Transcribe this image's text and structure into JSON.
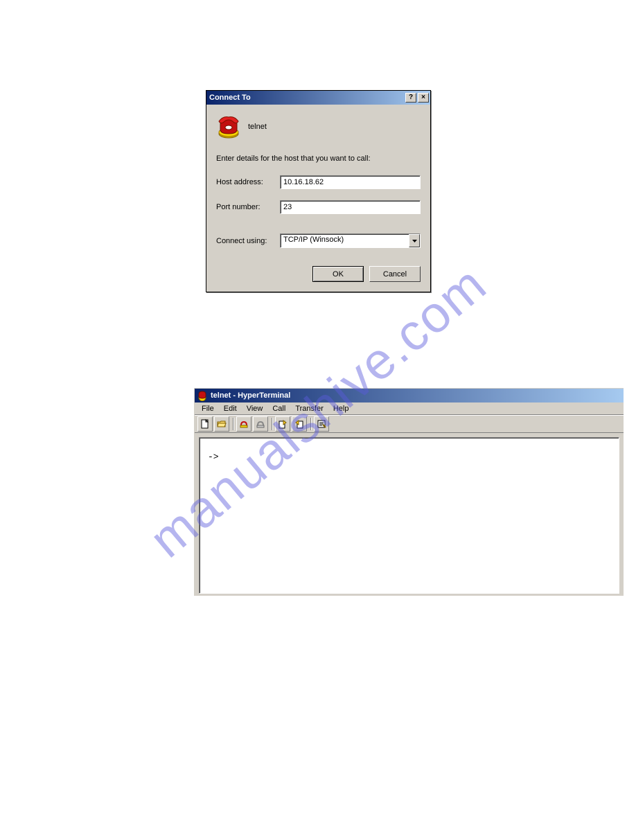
{
  "watermark": "manualshive.com",
  "dialog": {
    "title": "Connect To",
    "connection_name": "telnet",
    "prompt": "Enter details for the host that you want to call:",
    "fields": {
      "host_label": "Host address:",
      "host_value": "10.16.18.62",
      "port_label": "Port number:",
      "port_value": "23",
      "method_label": "Connect using:",
      "method_value": "TCP/IP (Winsock)"
    },
    "buttons": {
      "ok": "OK",
      "cancel": "Cancel"
    },
    "titlebar_buttons": {
      "help": "?",
      "close": "×"
    }
  },
  "window2": {
    "title": "telnet - HyperTerminal",
    "menus": [
      "File",
      "Edit",
      "View",
      "Call",
      "Transfer",
      "Help"
    ],
    "toolbar_icons": [
      "new",
      "open",
      "connect",
      "disconnect",
      "send",
      "receive",
      "properties"
    ],
    "terminal_content": "->"
  }
}
